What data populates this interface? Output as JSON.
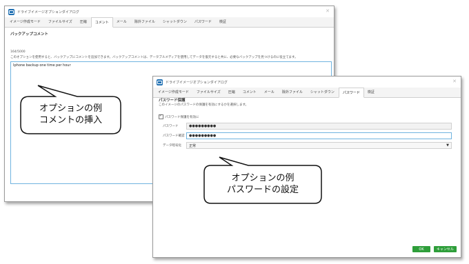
{
  "colors": {
    "accent": "#6fb3df",
    "ok_button": "#2e9e3a",
    "cancel_button": "#2e9e3a",
    "app_icon": "#1f6fb2"
  },
  "back_window": {
    "title": "ドライブイメージオプションダイアログ",
    "tabs": [
      "イメージ作成モード",
      "ファイルサイズ",
      "圧縮",
      "コメント",
      "メール",
      "除外ファイル",
      "シャットダウン",
      "パスワード",
      "検証"
    ],
    "active_tab": "コメント",
    "section_title": "バックアップコメント",
    "char_count": "164/5000",
    "description": "このオプションを使用すると、バックアップにコメントを追加できます。バックアップコメントは、データブルメディアを使用してデータを復元すると共に、必要なバックアップを見つけるのに役立てます。",
    "comment_text": "Iphone backup one time per hour"
  },
  "front_window": {
    "title": "ドライブイメージオプションダイアログ",
    "tabs": [
      "イメージ作成モード",
      "ファイルサイズ",
      "圧縮",
      "コメント",
      "メール",
      "除外ファイル",
      "シャットダウン",
      "パスワード",
      "検証"
    ],
    "active_tab": "パスワード",
    "section_title": "パスワード保護",
    "description": "このイメージのパスワードの保護を有効にするかを選択します。",
    "enable_checkbox_label": "パスワード保護を有効に",
    "password_label": "パスワード",
    "password_value": "●●●●●●●●●",
    "confirm_label": "パスワード確認",
    "confirm_value": "●●●●●●●●●",
    "encryption_label": "データ暗号化",
    "encryption_value": "正常",
    "ok_label": "OK",
    "cancel_label": "キャンセル"
  },
  "callout_comment": {
    "line1": "オプションの例",
    "line2": "コメントの挿入"
  },
  "callout_password": {
    "line1": "オプションの例",
    "line2": "パスワードの設定"
  }
}
